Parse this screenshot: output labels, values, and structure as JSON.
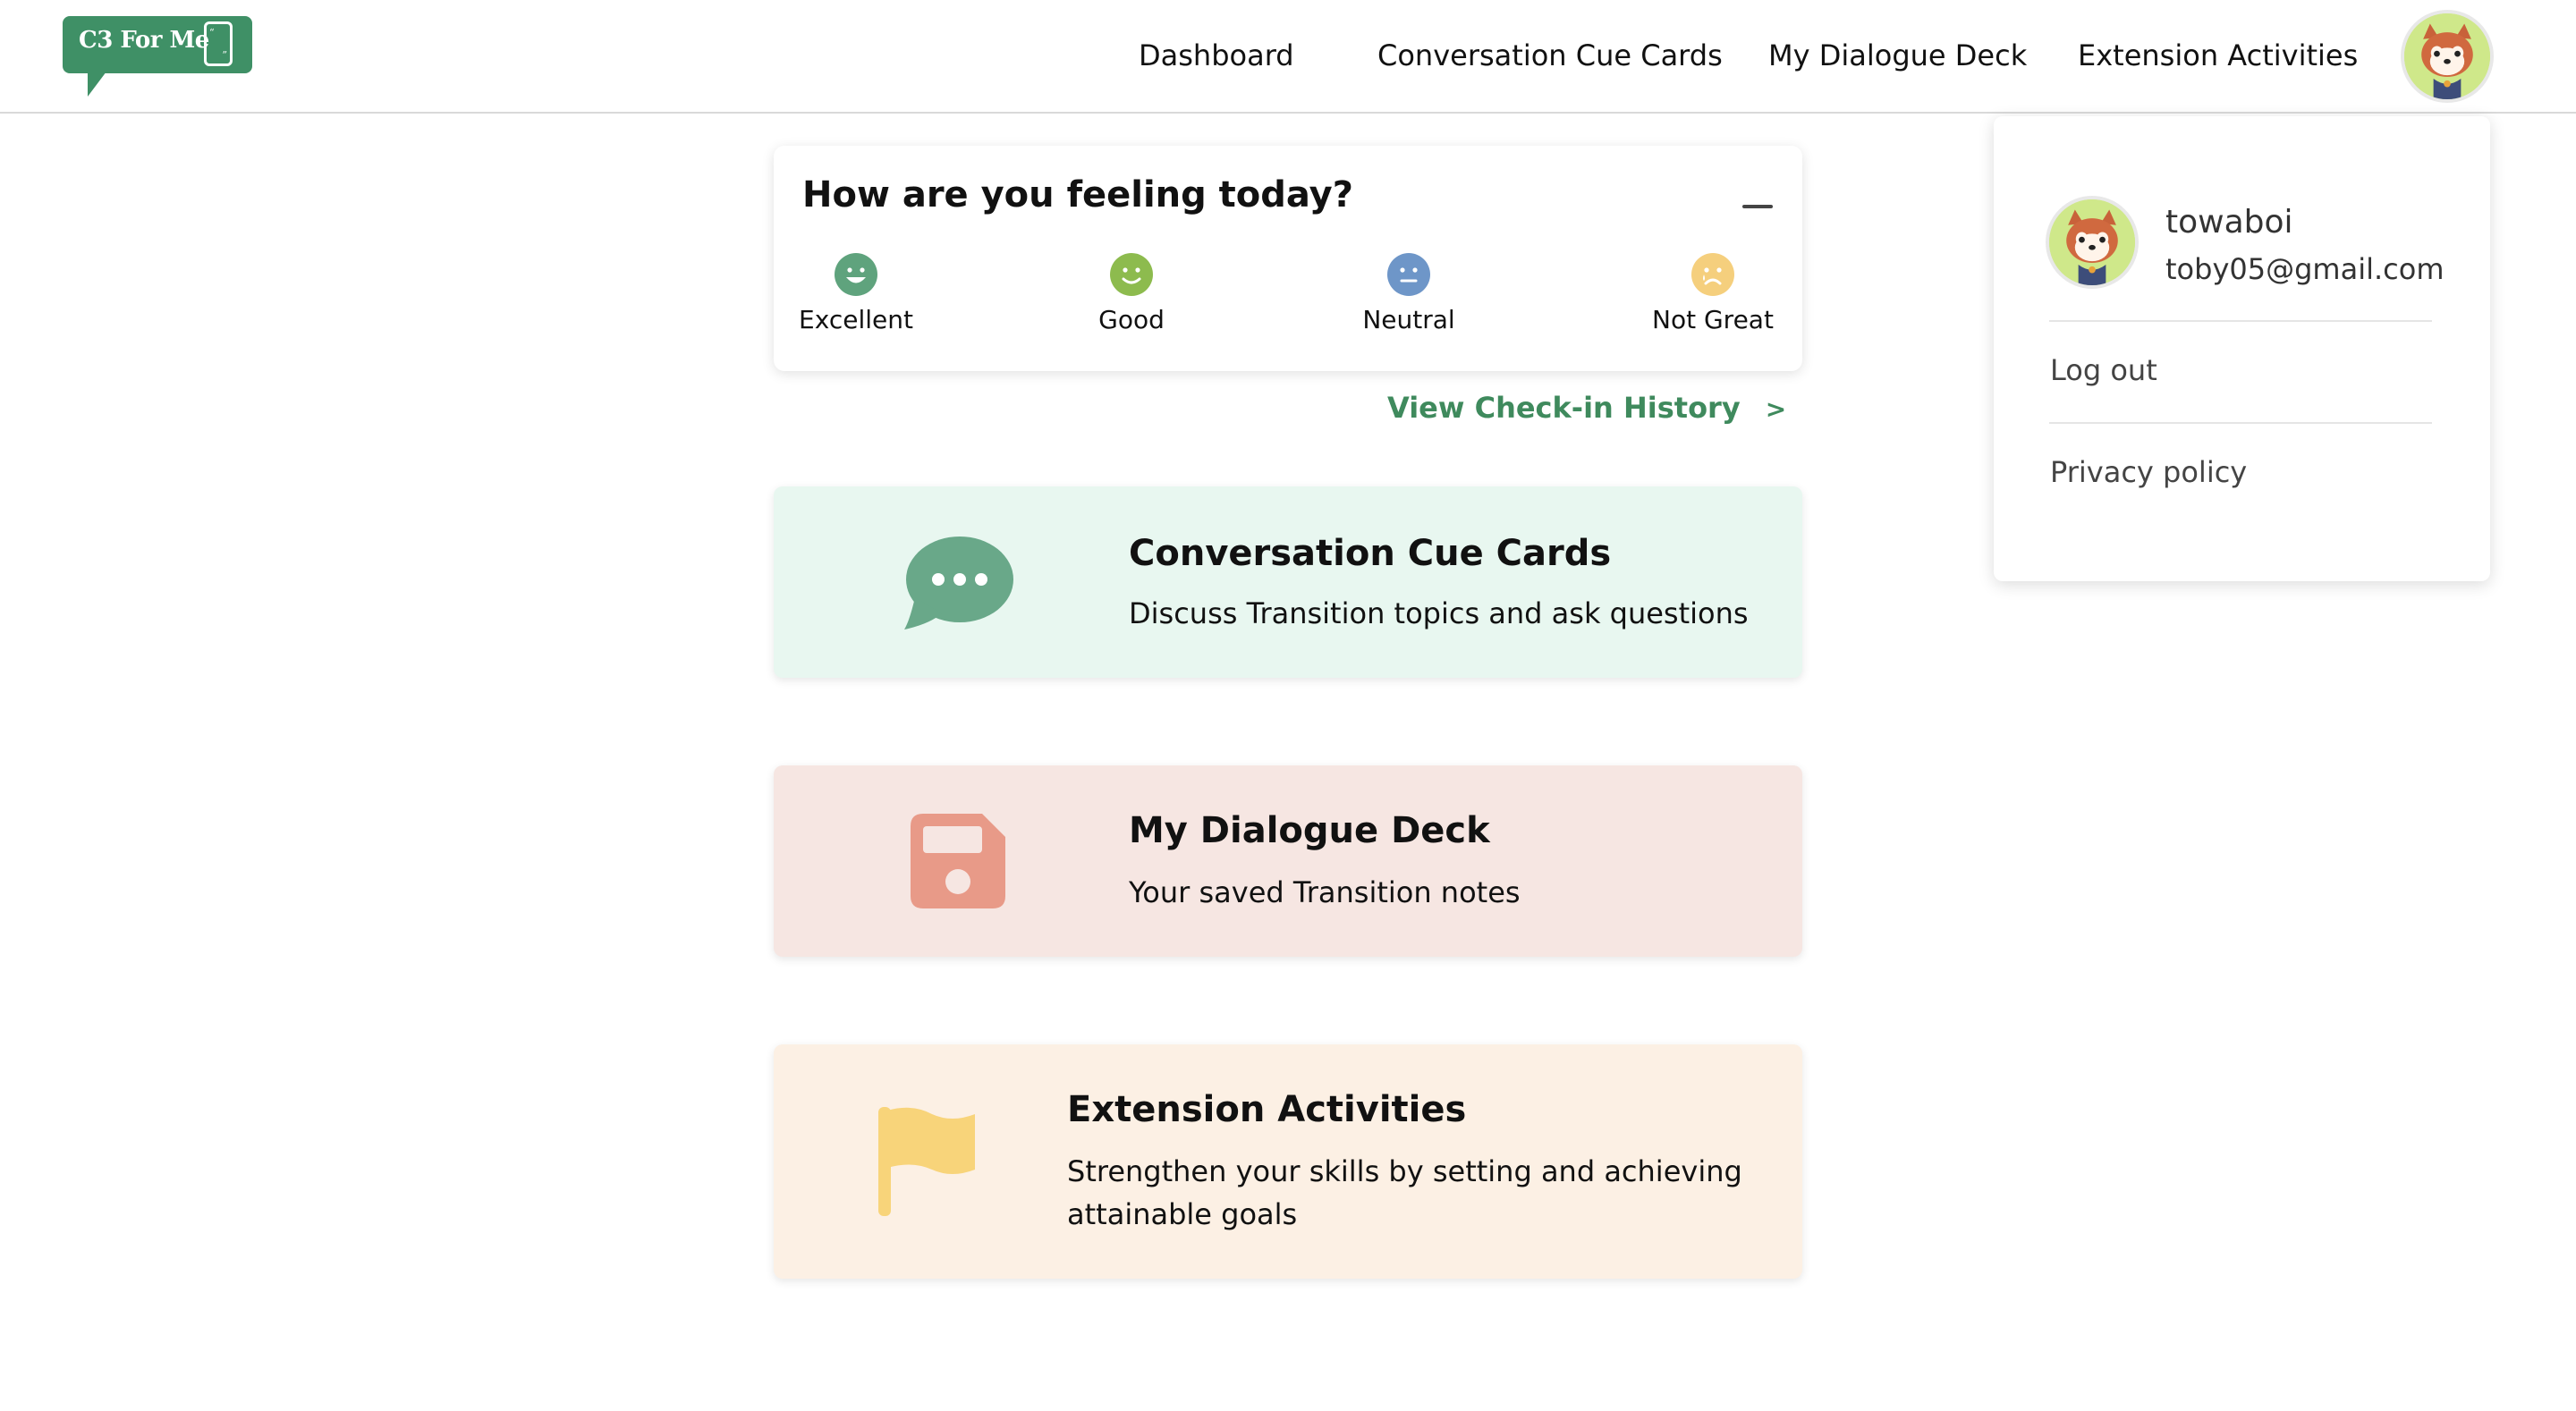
{
  "header": {
    "logo_text": "C3 For Me",
    "nav": {
      "dashboard": "Dashboard",
      "cue_cards": "Conversation Cue Cards",
      "dialogue_deck": "My Dialogue Deck",
      "extension": "Extension Activities"
    }
  },
  "feeling": {
    "title": "How are you feeling today?",
    "moods": [
      {
        "label": "Excellent",
        "color": "#5fa37d",
        "icon": "happy-face-icon"
      },
      {
        "label": "Good",
        "color": "#8dbb4e",
        "icon": "smile-face-icon"
      },
      {
        "label": "Neutral",
        "color": "#6e96c8",
        "icon": "neutral-face-icon"
      },
      {
        "label": "Not Great",
        "color": "#f5cf7d",
        "icon": "sad-face-icon"
      }
    ],
    "history_link": "View Check-in History",
    "history_chevron": ">"
  },
  "cards": [
    {
      "title": "Conversation Cue Cards",
      "desc": "Discuss Transition topics and ask questions",
      "icon": "chat-bubble-icon",
      "color": "#69a889",
      "bg": "#e8f7f0"
    },
    {
      "title": "My Dialogue Deck",
      "desc": "Your saved Transition notes",
      "icon": "save-disk-icon",
      "color": "#e89a88",
      "bg": "#f6e6e2"
    },
    {
      "title": "Extension Activities",
      "desc": "Strengthen your skills by setting and achieving attainable goals",
      "icon": "flag-icon",
      "color": "#f8d47a",
      "bg": "#fcf0e4"
    }
  ],
  "user_menu": {
    "username": "towaboi",
    "email": "toby05@gmail.com",
    "logout": "Log out",
    "privacy": "Privacy policy"
  },
  "colors": {
    "brand_green": "#3f9066",
    "link_green": "#3f8a5d"
  }
}
